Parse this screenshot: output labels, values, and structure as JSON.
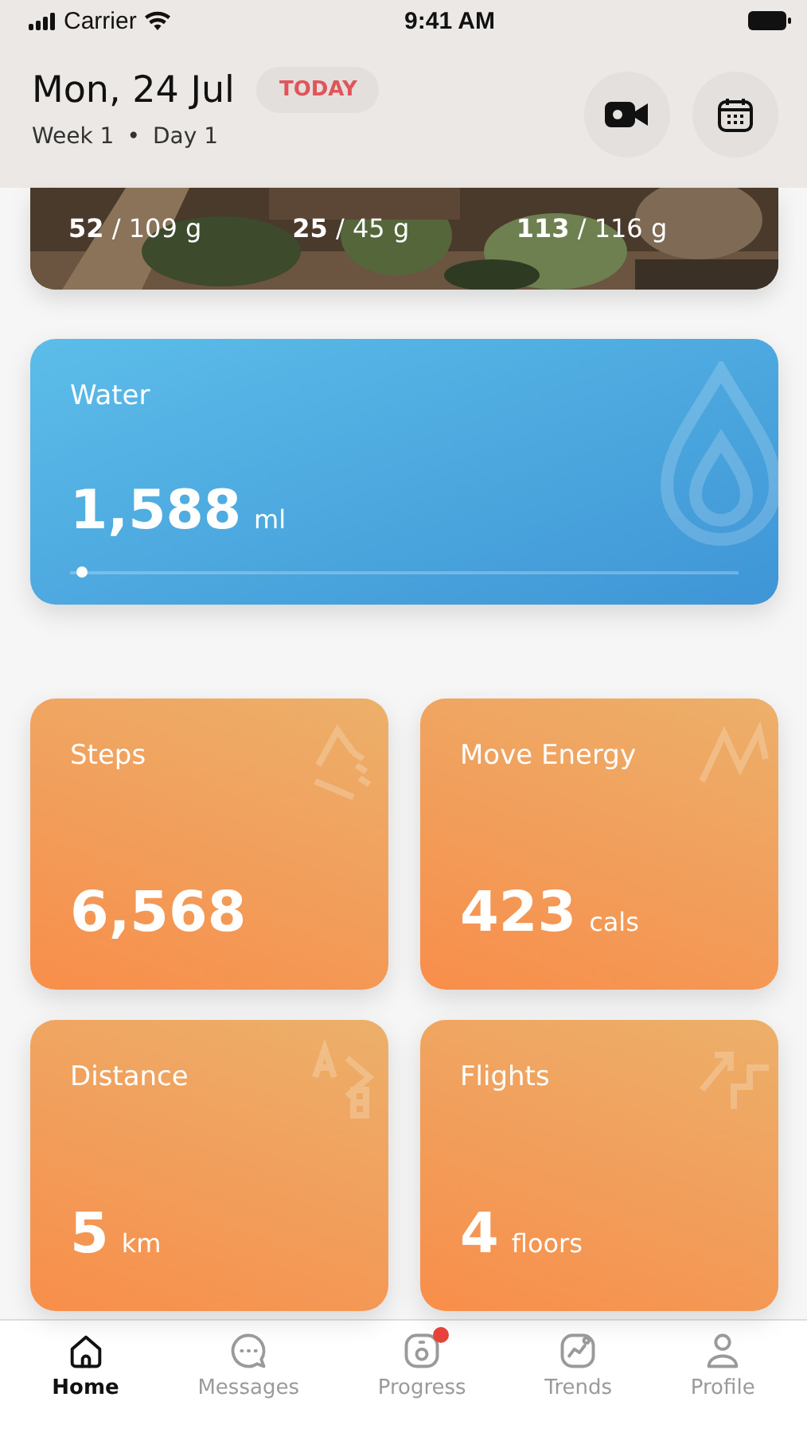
{
  "status_bar": {
    "carrier": "Carrier",
    "time": "9:41 AM"
  },
  "header": {
    "date": "Mon, 24 Jul",
    "badge": "TODAY",
    "week": "Week 1",
    "separator": "•",
    "day": "Day 1"
  },
  "macros": {
    "kind": "picture",
    "items": [
      {
        "value": "**52** / 109 g"
      },
      {
        "value": "**25** / 45 g"
      },
      {
        "value": "**113** / 116 g"
      }
    ]
  },
  "water": {
    "title": "Water",
    "value": "1,588",
    "unit": "ml",
    "level": 0.01
  },
  "metrics": [
    {
      "title": "Steps",
      "value": "6,568",
      "kind": "steps"
    },
    {
      "title": "Move Energy",
      "value": "423",
      "unit": "cals",
      "kind": "energy"
    },
    {
      "title": "Distance",
      "value": "5",
      "unit": "km",
      "kind": "distance"
    },
    {
      "title": "Flights",
      "value": "4",
      "unit": "floors",
      "kind": "flights"
    }
  ],
  "tabs": [
    {
      "label": "Home",
      "kind": "home",
      "selected": true,
      "badge": false
    },
    {
      "label": "Messages",
      "kind": "messages",
      "selected": false,
      "badge": false
    },
    {
      "label": "Progress",
      "kind": "progress",
      "selected": false,
      "badge": true
    },
    {
      "label": "Trends",
      "kind": "trends",
      "selected": false,
      "badge": false
    },
    {
      "label": "Profile",
      "kind": "profile",
      "selected": false,
      "badge": false
    }
  ]
}
